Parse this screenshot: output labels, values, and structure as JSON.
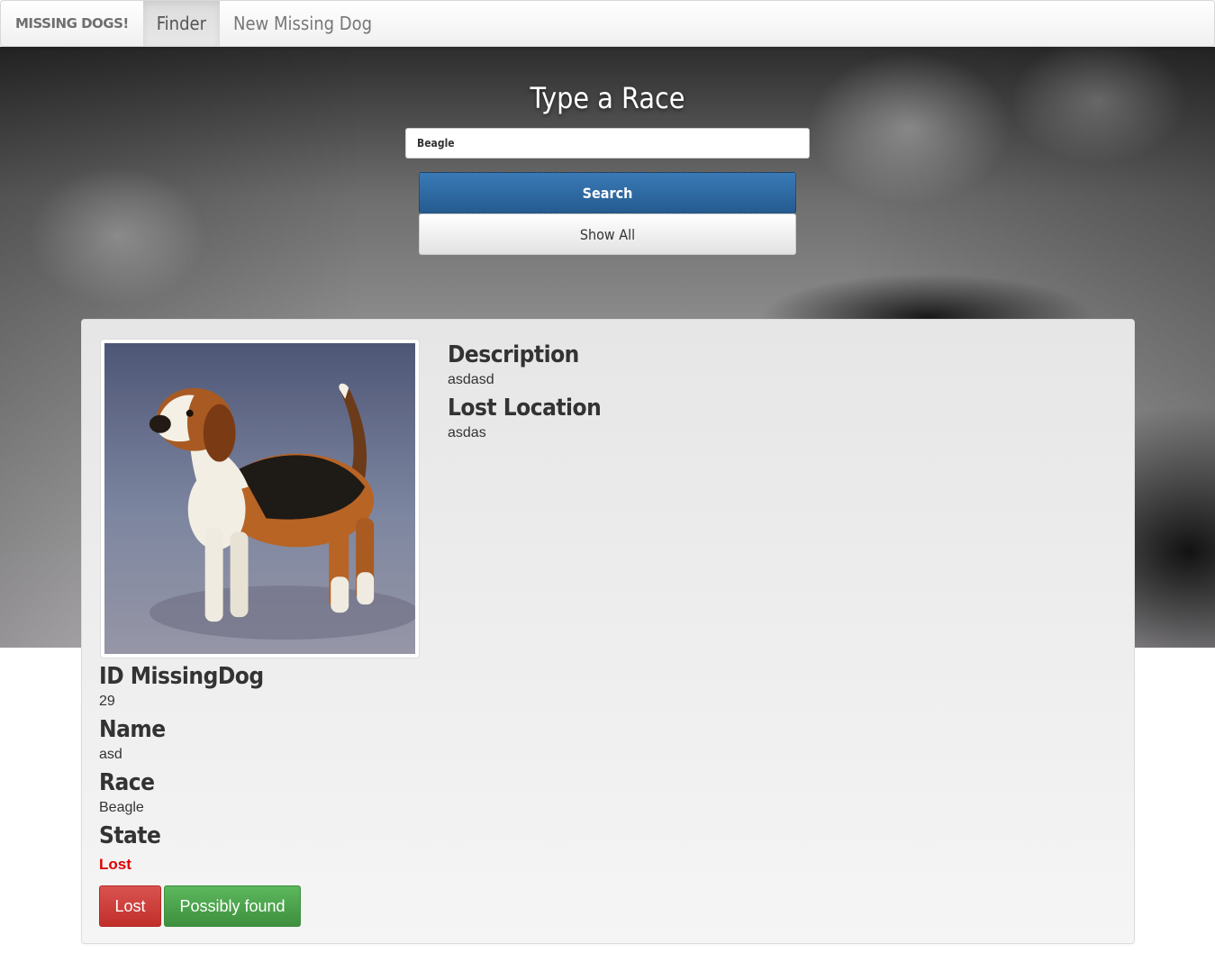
{
  "navbar": {
    "brand": "MISSING DOGS!",
    "items": [
      {
        "label": "Finder",
        "active": true
      },
      {
        "label": "New Missing Dog",
        "active": false
      }
    ]
  },
  "search": {
    "title": "Type a Race",
    "input_value": "Beagle",
    "search_label": "Search",
    "show_all_label": "Show All"
  },
  "dog": {
    "image_icon": "beagle-photo",
    "description_label": "Description",
    "description": "asdasd",
    "lost_location_label": "Lost Location",
    "lost_location": "asdas",
    "id_label": "ID MissingDog",
    "id": "29",
    "name_label": "Name",
    "name": "asd",
    "race_label": "Race",
    "race": "Beagle",
    "state_label": "State",
    "state": "Lost",
    "state_color": "#e00000"
  },
  "actions": {
    "lost_label": "Lost",
    "possibly_found_label": "Possibly found"
  }
}
